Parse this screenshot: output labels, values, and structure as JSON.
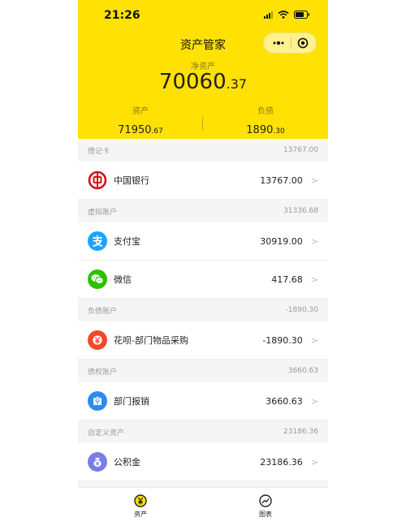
{
  "status_bar": {
    "time": "21:26"
  },
  "nav": {
    "title": "资产管家"
  },
  "net_assets": {
    "label": "净资产",
    "value_int": "70060",
    "value_dec": ".37"
  },
  "summary": {
    "assets": {
      "label": "资产",
      "value_int": "71950",
      "value_dec": ".67"
    },
    "liabilities": {
      "label": "负债",
      "value_int": "1890",
      "value_dec": ".30"
    }
  },
  "sections": [
    {
      "title": "借记卡",
      "total": "13767.00",
      "items": [
        {
          "name": "中国银行",
          "amount": "13767.00",
          "icon": "bank-of-china-icon"
        }
      ]
    },
    {
      "title": "虚拟账户",
      "total": "31336.68",
      "items": [
        {
          "name": "支付宝",
          "amount": "30919.00",
          "icon": "alipay-icon"
        },
        {
          "name": "微信",
          "amount": "417.68",
          "icon": "wechat-icon"
        }
      ]
    },
    {
      "title": "负债账户",
      "total": "-1890.30",
      "items": [
        {
          "name": "花呗-部门物品采购",
          "amount": "-1890.30",
          "icon": "huabei-icon"
        }
      ]
    },
    {
      "title": "债权账户",
      "total": "3660.63",
      "items": [
        {
          "name": "部门报销",
          "amount": "3660.63",
          "icon": "reimbursement-icon"
        }
      ]
    },
    {
      "title": "自定义资产",
      "total": "23186.36",
      "items": [
        {
          "name": "公积金",
          "amount": "23186.36",
          "icon": "housing-fund-icon"
        }
      ]
    }
  ],
  "tabs": [
    {
      "label": "资产",
      "icon": "yen-coin-icon"
    },
    {
      "label": "图表",
      "icon": "trend-chart-icon"
    }
  ],
  "colors": {
    "header_bg": "#ffe104",
    "bank_red": "#d0111b",
    "alipay_blue": "#1aa3ff",
    "wechat_green": "#2dc100",
    "huabei_red": "#f04a2a",
    "reimburse_blue": "#2a8cf0",
    "fund_purple": "#7b7de6"
  }
}
